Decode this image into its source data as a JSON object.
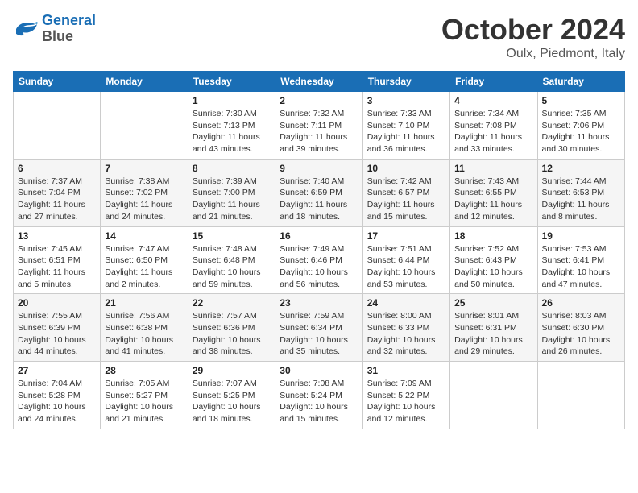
{
  "header": {
    "logo_line1": "General",
    "logo_line2": "Blue",
    "month_title": "October 2024",
    "location": "Oulx, Piedmont, Italy"
  },
  "weekdays": [
    "Sunday",
    "Monday",
    "Tuesday",
    "Wednesday",
    "Thursday",
    "Friday",
    "Saturday"
  ],
  "weeks": [
    [
      {
        "day": "",
        "info": ""
      },
      {
        "day": "",
        "info": ""
      },
      {
        "day": "1",
        "info": "Sunrise: 7:30 AM\nSunset: 7:13 PM\nDaylight: 11 hours and 43 minutes."
      },
      {
        "day": "2",
        "info": "Sunrise: 7:32 AM\nSunset: 7:11 PM\nDaylight: 11 hours and 39 minutes."
      },
      {
        "day": "3",
        "info": "Sunrise: 7:33 AM\nSunset: 7:10 PM\nDaylight: 11 hours and 36 minutes."
      },
      {
        "day": "4",
        "info": "Sunrise: 7:34 AM\nSunset: 7:08 PM\nDaylight: 11 hours and 33 minutes."
      },
      {
        "day": "5",
        "info": "Sunrise: 7:35 AM\nSunset: 7:06 PM\nDaylight: 11 hours and 30 minutes."
      }
    ],
    [
      {
        "day": "6",
        "info": "Sunrise: 7:37 AM\nSunset: 7:04 PM\nDaylight: 11 hours and 27 minutes."
      },
      {
        "day": "7",
        "info": "Sunrise: 7:38 AM\nSunset: 7:02 PM\nDaylight: 11 hours and 24 minutes."
      },
      {
        "day": "8",
        "info": "Sunrise: 7:39 AM\nSunset: 7:00 PM\nDaylight: 11 hours and 21 minutes."
      },
      {
        "day": "9",
        "info": "Sunrise: 7:40 AM\nSunset: 6:59 PM\nDaylight: 11 hours and 18 minutes."
      },
      {
        "day": "10",
        "info": "Sunrise: 7:42 AM\nSunset: 6:57 PM\nDaylight: 11 hours and 15 minutes."
      },
      {
        "day": "11",
        "info": "Sunrise: 7:43 AM\nSunset: 6:55 PM\nDaylight: 11 hours and 12 minutes."
      },
      {
        "day": "12",
        "info": "Sunrise: 7:44 AM\nSunset: 6:53 PM\nDaylight: 11 hours and 8 minutes."
      }
    ],
    [
      {
        "day": "13",
        "info": "Sunrise: 7:45 AM\nSunset: 6:51 PM\nDaylight: 11 hours and 5 minutes."
      },
      {
        "day": "14",
        "info": "Sunrise: 7:47 AM\nSunset: 6:50 PM\nDaylight: 11 hours and 2 minutes."
      },
      {
        "day": "15",
        "info": "Sunrise: 7:48 AM\nSunset: 6:48 PM\nDaylight: 10 hours and 59 minutes."
      },
      {
        "day": "16",
        "info": "Sunrise: 7:49 AM\nSunset: 6:46 PM\nDaylight: 10 hours and 56 minutes."
      },
      {
        "day": "17",
        "info": "Sunrise: 7:51 AM\nSunset: 6:44 PM\nDaylight: 10 hours and 53 minutes."
      },
      {
        "day": "18",
        "info": "Sunrise: 7:52 AM\nSunset: 6:43 PM\nDaylight: 10 hours and 50 minutes."
      },
      {
        "day": "19",
        "info": "Sunrise: 7:53 AM\nSunset: 6:41 PM\nDaylight: 10 hours and 47 minutes."
      }
    ],
    [
      {
        "day": "20",
        "info": "Sunrise: 7:55 AM\nSunset: 6:39 PM\nDaylight: 10 hours and 44 minutes."
      },
      {
        "day": "21",
        "info": "Sunrise: 7:56 AM\nSunset: 6:38 PM\nDaylight: 10 hours and 41 minutes."
      },
      {
        "day": "22",
        "info": "Sunrise: 7:57 AM\nSunset: 6:36 PM\nDaylight: 10 hours and 38 minutes."
      },
      {
        "day": "23",
        "info": "Sunrise: 7:59 AM\nSunset: 6:34 PM\nDaylight: 10 hours and 35 minutes."
      },
      {
        "day": "24",
        "info": "Sunrise: 8:00 AM\nSunset: 6:33 PM\nDaylight: 10 hours and 32 minutes."
      },
      {
        "day": "25",
        "info": "Sunrise: 8:01 AM\nSunset: 6:31 PM\nDaylight: 10 hours and 29 minutes."
      },
      {
        "day": "26",
        "info": "Sunrise: 8:03 AM\nSunset: 6:30 PM\nDaylight: 10 hours and 26 minutes."
      }
    ],
    [
      {
        "day": "27",
        "info": "Sunrise: 7:04 AM\nSunset: 5:28 PM\nDaylight: 10 hours and 24 minutes."
      },
      {
        "day": "28",
        "info": "Sunrise: 7:05 AM\nSunset: 5:27 PM\nDaylight: 10 hours and 21 minutes."
      },
      {
        "day": "29",
        "info": "Sunrise: 7:07 AM\nSunset: 5:25 PM\nDaylight: 10 hours and 18 minutes."
      },
      {
        "day": "30",
        "info": "Sunrise: 7:08 AM\nSunset: 5:24 PM\nDaylight: 10 hours and 15 minutes."
      },
      {
        "day": "31",
        "info": "Sunrise: 7:09 AM\nSunset: 5:22 PM\nDaylight: 10 hours and 12 minutes."
      },
      {
        "day": "",
        "info": ""
      },
      {
        "day": "",
        "info": ""
      }
    ]
  ]
}
